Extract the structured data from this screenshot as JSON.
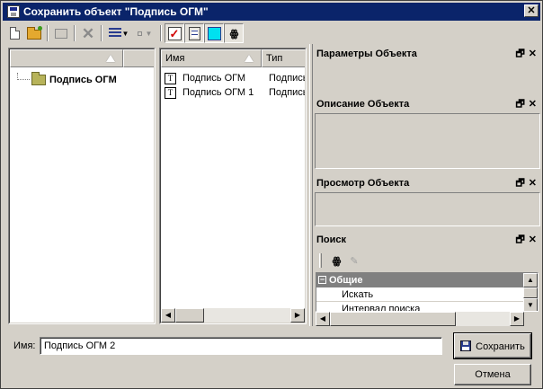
{
  "window": {
    "title": "Сохранить объект \"Подпись ОГМ\"",
    "close_glyph": "✕"
  },
  "toolbar": {
    "buttons": [
      "new-document-icon",
      "open-folder-icon",
      "up-level-icon",
      "delete-icon",
      "view-list-icon",
      "dropdown-arrow-icon",
      "small-square-icon",
      "dropdown-arrow-icon",
      "checkmark-icon",
      "document-lines-icon",
      "cyan-square-icon",
      "binoculars-icon"
    ]
  },
  "tree": {
    "root_label": "Подпись ОГМ"
  },
  "filelist": {
    "columns": [
      "Имя",
      "Тип"
    ],
    "rows": [
      {
        "icon": "T",
        "name": "Подпись ОГМ",
        "type": "Подпись"
      },
      {
        "icon": "T",
        "name": "Подпись ОГМ 1",
        "type": "Подпись"
      }
    ]
  },
  "panels": {
    "params": {
      "title": "Параметры Объекта"
    },
    "description": {
      "title": "Описание Объекта"
    },
    "preview": {
      "title": "Просмотр Объекта"
    },
    "search": {
      "title": "Поиск",
      "category": "Общие",
      "rows": [
        "Искать",
        "Интервал поиска"
      ]
    },
    "dock_glyphs": {
      "pin": "🗗",
      "close": "✕"
    }
  },
  "form": {
    "name_label": "Имя:",
    "name_value": "Подпись ОГМ 2",
    "save_label": "Сохранить",
    "cancel_label": "Отмена"
  }
}
